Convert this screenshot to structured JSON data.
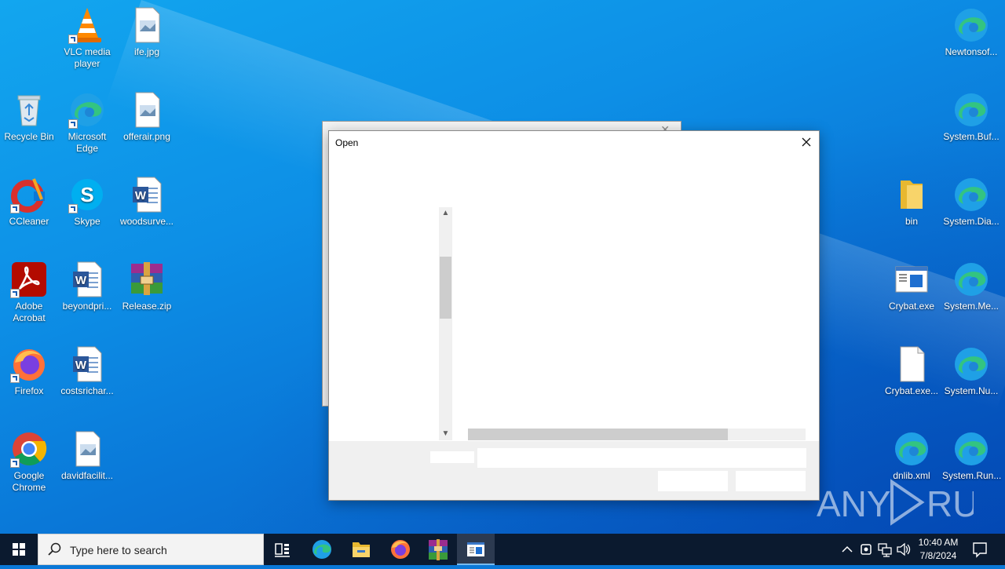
{
  "desktop_icons": [
    {
      "label": "VLC media player"
    },
    {
      "label": "ife.jpg"
    },
    {
      "label": "Recycle Bin"
    },
    {
      "label": "Microsoft Edge"
    },
    {
      "label": "offerair.png"
    },
    {
      "label": "CCleaner"
    },
    {
      "label": "Skype"
    },
    {
      "label": "woodsurve..."
    },
    {
      "label": "Adobe Acrobat"
    },
    {
      "label": "beyondpri..."
    },
    {
      "label": "Release.zip"
    },
    {
      "label": "Firefox"
    },
    {
      "label": "costsrichar..."
    },
    {
      "label": "Google Chrome"
    },
    {
      "label": "davidfacilit..."
    },
    {
      "label": "Newtonsof..."
    },
    {
      "label": "System.Buf..."
    },
    {
      "label": "bin"
    },
    {
      "label": "System.Dia..."
    },
    {
      "label": "Crybat.exe"
    },
    {
      "label": "System.Me..."
    },
    {
      "label": "Crybat.exe..."
    },
    {
      "label": "System.Nu..."
    },
    {
      "label": "dnlib.xml"
    },
    {
      "label": "System.Run..."
    }
  ],
  "dialog": {
    "title": "Open"
  },
  "watermark": {
    "text": "ANY RUN"
  },
  "taskbar": {
    "search_placeholder": "Type here to search",
    "time": "10:40 AM",
    "date": "7/8/2024"
  },
  "colors": {
    "desktop": "#0a78d7",
    "taskbar": "#0b1a2f",
    "accent": "#76b9ed"
  }
}
